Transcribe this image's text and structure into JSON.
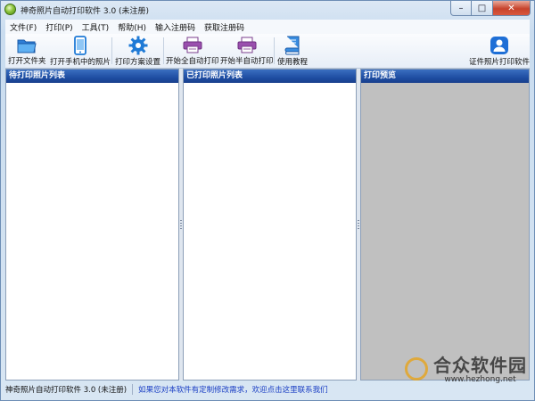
{
  "window": {
    "title": "神奇照片自动打印软件 3.0 (未注册)",
    "controls": {
      "minimize": "–",
      "maximize": "□",
      "close": "✕"
    }
  },
  "menubar": {
    "items": [
      {
        "label": "文件(F)"
      },
      {
        "label": "打印(P)"
      },
      {
        "label": "工具(T)"
      },
      {
        "label": "帮助(H)"
      },
      {
        "label": "输入注册码"
      },
      {
        "label": "获取注册码"
      }
    ]
  },
  "toolbar": {
    "open_folder": {
      "label": "打开文件夹",
      "icon": "folder-icon"
    },
    "open_phone": {
      "label": "打开手机中的照片",
      "icon": "phone-icon"
    },
    "print_settings": {
      "label": "打印方案设置",
      "icon": "gear-icon"
    },
    "auto_print": {
      "label": "开始全自动打印",
      "icon": "printer-icon"
    },
    "semi_auto_print": {
      "label": "开始半自动打印",
      "icon": "printer-icon"
    },
    "tutorial": {
      "label": "使用教程",
      "icon": "book-icon"
    },
    "id_photo": {
      "label": "证件照片打印软件",
      "icon": "person-icon"
    }
  },
  "panels": {
    "pending": {
      "title": "待打印照片列表"
    },
    "printed": {
      "title": "已打印照片列表"
    },
    "preview": {
      "title": "打印预览"
    }
  },
  "statusbar": {
    "app": "神奇照片自动打印软件 3.0 (未注册)",
    "link": "如果您对本软件有定制修改需求，欢迎点击这里联系我们"
  },
  "watermark": {
    "title": "合众软件园",
    "url": "www.hezhong.net"
  },
  "colors": {
    "panel_header": "#1f4ea3",
    "preview_bg": "#c0c0c0",
    "link": "#1b3fc4"
  }
}
